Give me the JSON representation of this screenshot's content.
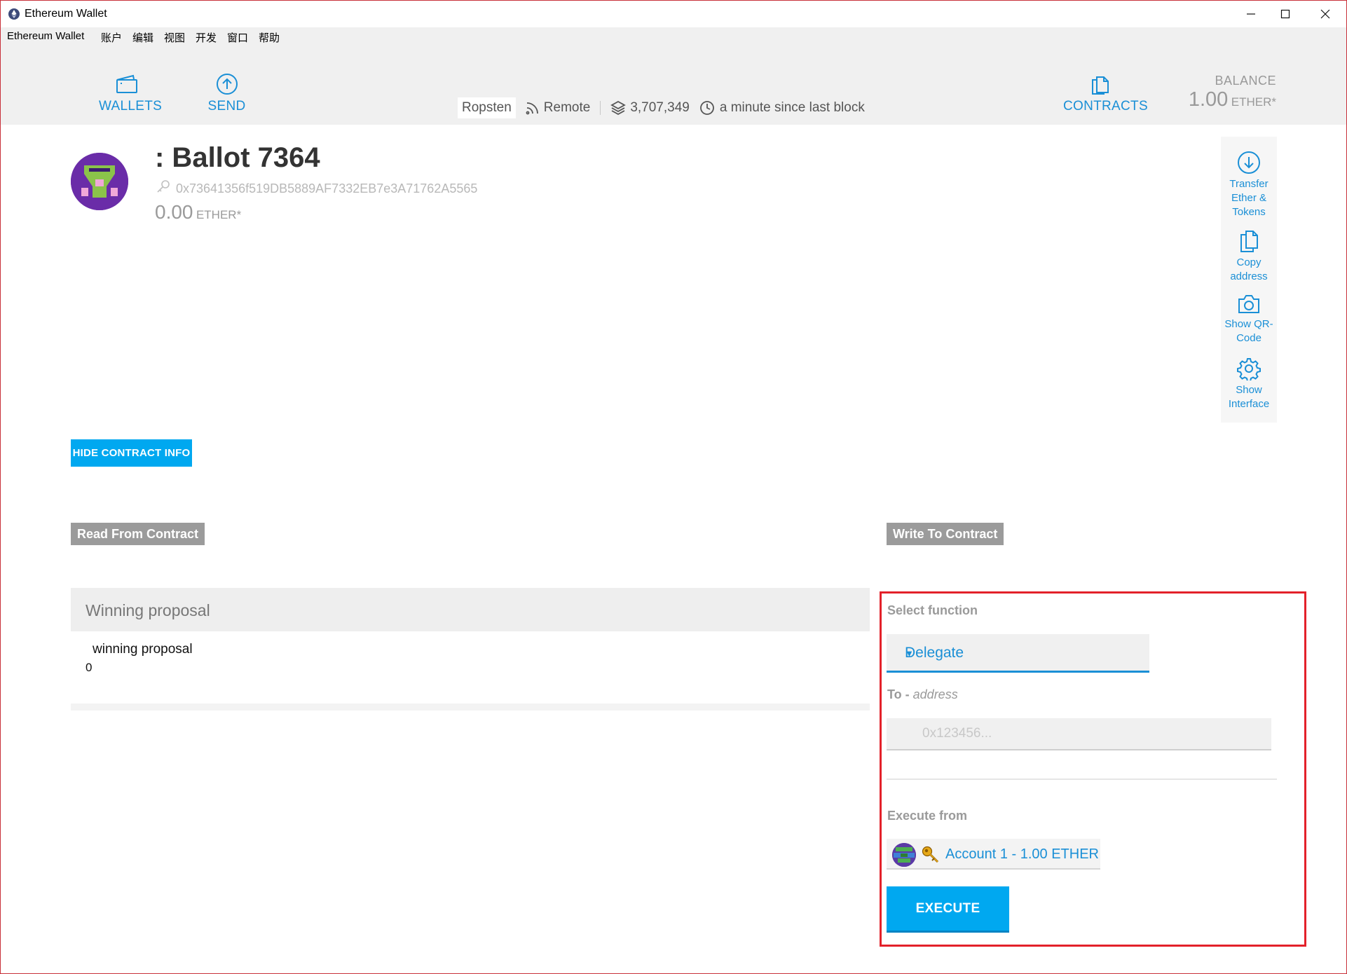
{
  "window": {
    "title": "Ethereum Wallet"
  },
  "menu": [
    "Ethereum Wallet",
    "账户",
    "编辑",
    "视图",
    "开发",
    "窗口",
    "帮助"
  ],
  "nav": {
    "wallets_label": "WALLETS",
    "send_label": "SEND",
    "contracts_label": "CONTRACTS"
  },
  "status": {
    "network": "Ropsten",
    "mode": "Remote",
    "block_number": "3,707,349",
    "last_block": "a minute since last block"
  },
  "balance": {
    "label": "BALANCE",
    "value": "1.00",
    "unit": "ETHER*"
  },
  "contract": {
    "title": ": Ballot 7364",
    "address": "0x73641356f519DB5889AF7332EB7e3A71762A5565",
    "balance_value": "0.00",
    "balance_unit": "ETHER*"
  },
  "actions": [
    {
      "label": "Transfer Ether & Tokens",
      "icon": "download-circle-icon"
    },
    {
      "label": "Copy address",
      "icon": "copy-icon"
    },
    {
      "label": "Show QR-Code",
      "icon": "camera-icon"
    },
    {
      "label": "Show Interface",
      "icon": "gear-icon"
    }
  ],
  "buttons": {
    "hide_contract_info": "HIDE CONTRACT INFO",
    "execute": "EXECUTE"
  },
  "sections": {
    "read": "Read From Contract",
    "write": "Write To Contract"
  },
  "read": {
    "title": "Winning proposal",
    "field_name": "winning proposal",
    "field_value": "0"
  },
  "write": {
    "select_function_label": "Select function",
    "selected_function": "Delegate",
    "to_label": "To - ",
    "to_type": "address",
    "to_placeholder": "0x123456...",
    "execute_from_label": "Execute from",
    "account": "Account 1 - 1.00 ETHER"
  },
  "colors": {
    "accent": "#1a8fd6",
    "button": "#00a8f0",
    "highlight": "#e3212a",
    "header_bg": "#f0f0f0"
  }
}
